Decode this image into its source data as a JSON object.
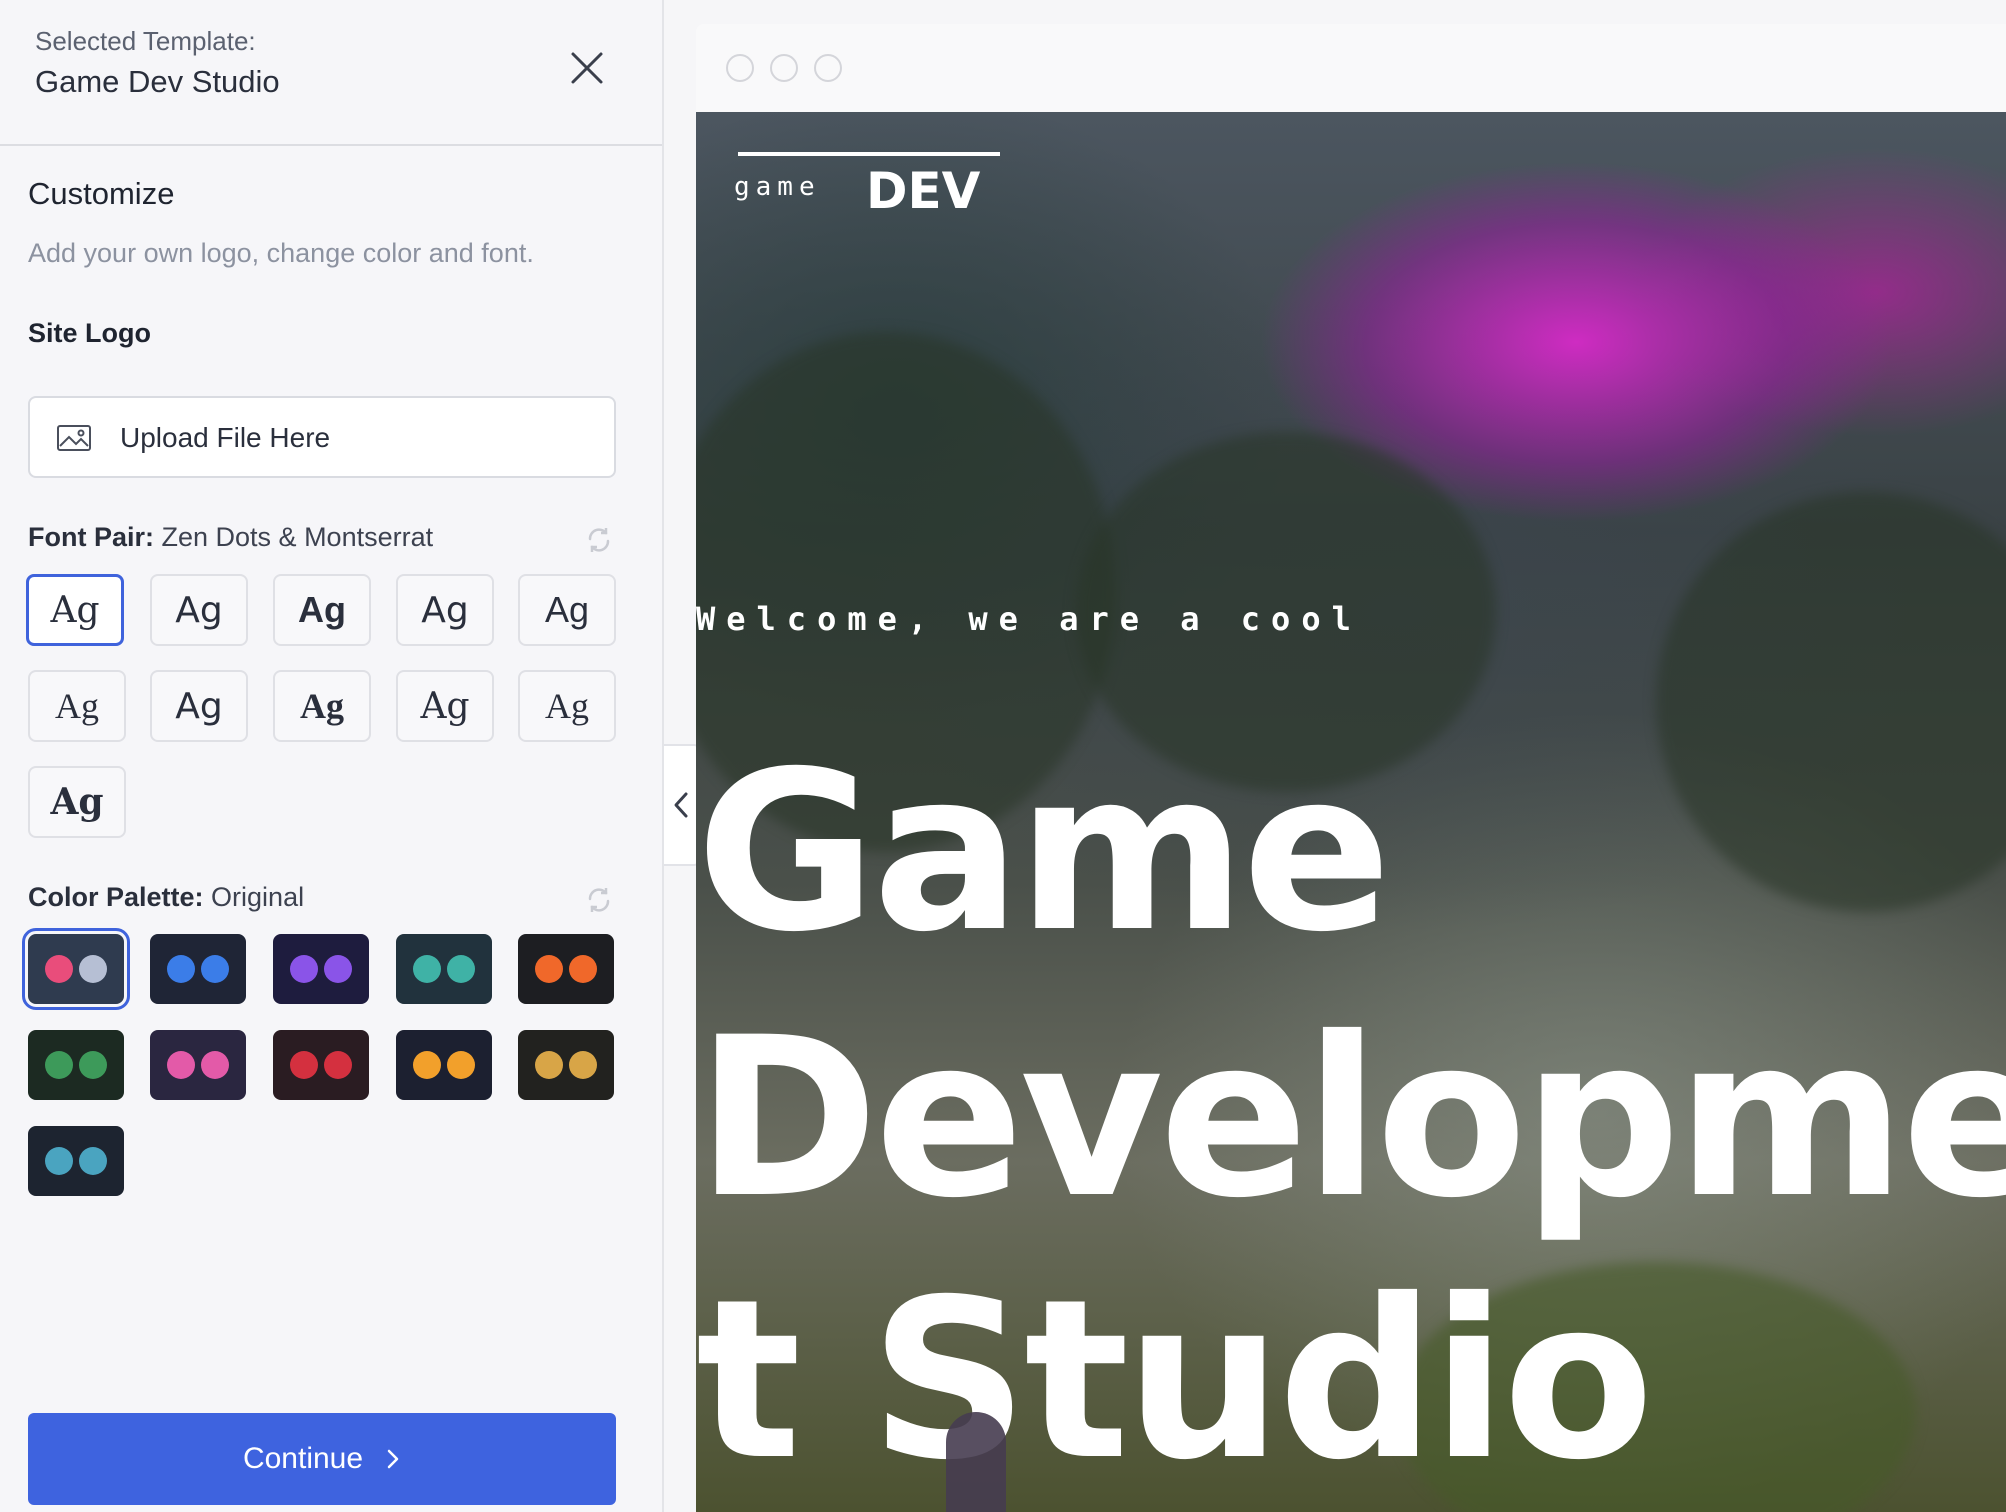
{
  "sidebar": {
    "header_sub": "Selected Template:",
    "header_title": "Game Dev Studio",
    "customize_title": "Customize",
    "customize_desc": "Add your own logo, change color and font.",
    "site_logo_label": "Site Logo",
    "upload_label": "Upload File Here",
    "font_pair_label": "Font Pair:",
    "font_pair_value": "Zen Dots & Montserrat",
    "font_tiles": [
      "Ag",
      "Ag",
      "Ag",
      "Ag",
      "Ag",
      "Ag",
      "Ag",
      "Ag",
      "Ag",
      "Ag",
      "Ag"
    ],
    "color_palette_label": "Color Palette:",
    "color_palette_value": "Original",
    "palettes": [
      {
        "bg": "#2f3b4f",
        "c1": "#e94d7b",
        "c2": "#b6bfd4"
      },
      {
        "bg": "#1f2536",
        "c1": "#3b7de8",
        "c2": "#3b7de8"
      },
      {
        "bg": "#1e1c3e",
        "c1": "#8a54e8",
        "c2": "#8a54e8"
      },
      {
        "bg": "#21323d",
        "c1": "#3fb2a6",
        "c2": "#3fb2a6"
      },
      {
        "bg": "#1d1e22",
        "c1": "#f0682a",
        "c2": "#f0682a"
      },
      {
        "bg": "#1c2a22",
        "c1": "#3d9a5a",
        "c2": "#3d9a5a"
      },
      {
        "bg": "#2a2640",
        "c1": "#e35aa8",
        "c2": "#e35aa8"
      },
      {
        "bg": "#2a1c22",
        "c1": "#d4303f",
        "c2": "#d4303f"
      },
      {
        "bg": "#1c2030",
        "c1": "#f2a02b",
        "c2": "#f2a02b"
      },
      {
        "bg": "#22221f",
        "c1": "#d8a547",
        "c2": "#d8a547"
      },
      {
        "bg": "#1d2430",
        "c1": "#4aa4c0",
        "c2": "#4aa4c0"
      }
    ],
    "continue_label": "Continue",
    "accent_color": "#3e63df"
  },
  "preview": {
    "logo_small": "game",
    "logo_big": "DEV",
    "welcome_text": "Welcome, we are a cool",
    "headline_line1": "Game",
    "headline_line2": "Developme",
    "headline_line3": "t Studio"
  }
}
